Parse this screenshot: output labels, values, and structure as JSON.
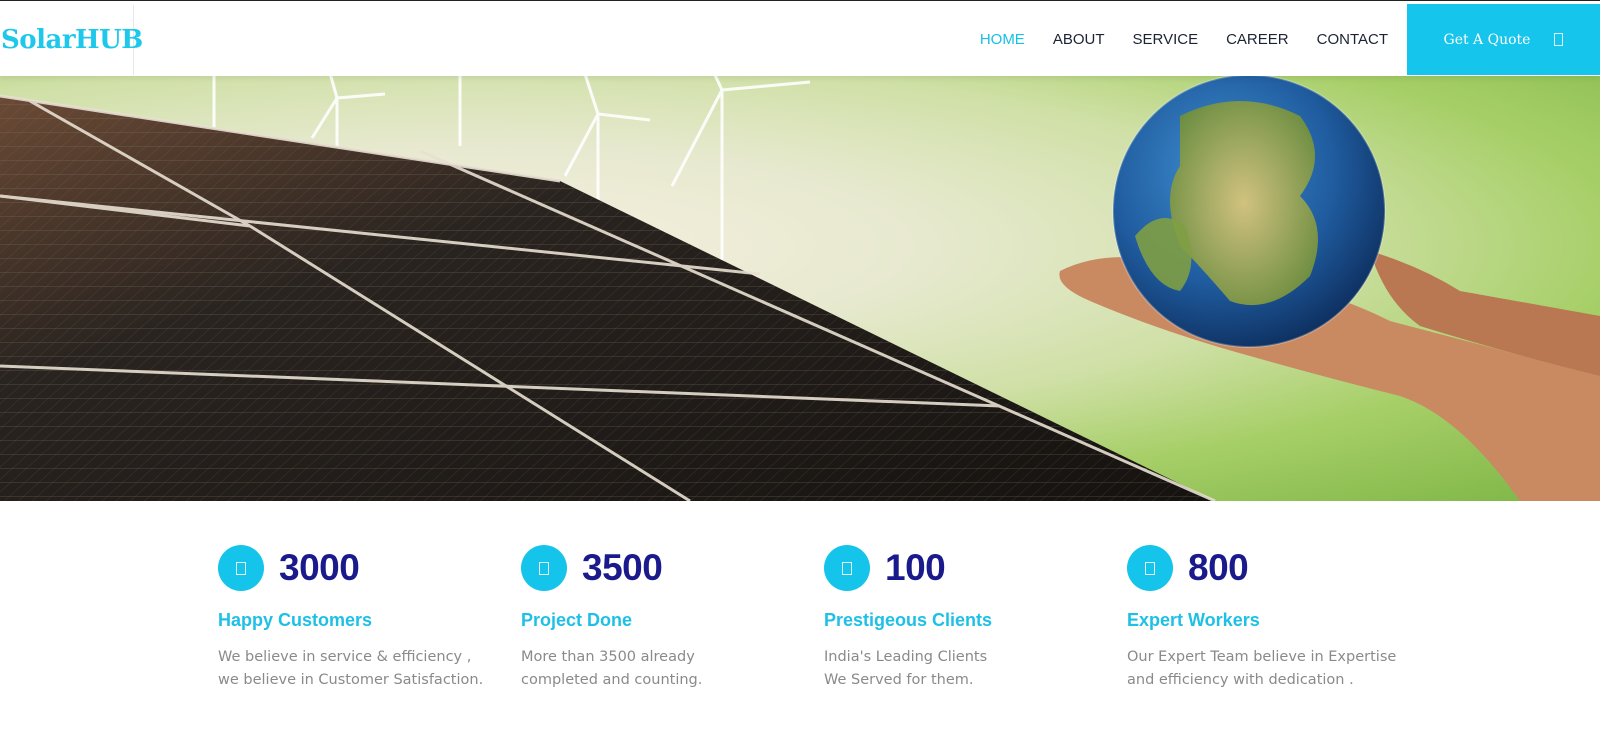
{
  "brand": {
    "name": "SolarHUB"
  },
  "nav": {
    "items": [
      {
        "label": "HOME",
        "active": true
      },
      {
        "label": "ABOUT"
      },
      {
        "label": "SERVICE"
      },
      {
        "label": "CAREER"
      },
      {
        "label": "CONTACT"
      }
    ],
    "cta_label": "Get A Quote"
  },
  "hero": {
    "image": "solar-panels-and-hands-holding-earth"
  },
  "stats": [
    {
      "number": "3000",
      "title": "Happy Customers",
      "desc_line1": "We believe in service & efficiency ,",
      "desc_line2": "we believe in Customer Satisfaction."
    },
    {
      "number": "3500",
      "title": "Project Done",
      "desc_line1": "More than 3500 already",
      "desc_line2": "completed and counting."
    },
    {
      "number": "100",
      "title": "Prestigeous Clients",
      "desc_line1": "India's Leading Clients",
      "desc_line2": "We Served for them."
    },
    {
      "number": "800",
      "title": "Expert Workers",
      "desc_line1": "Our Expert Team believe in Expertise",
      "desc_line2": "and efficiency with dedication ."
    }
  ],
  "colors": {
    "accent": "#15c5ec",
    "number": "#1a1a8c",
    "nav_text": "#1c2333",
    "muted_text": "#8a8a8a"
  }
}
